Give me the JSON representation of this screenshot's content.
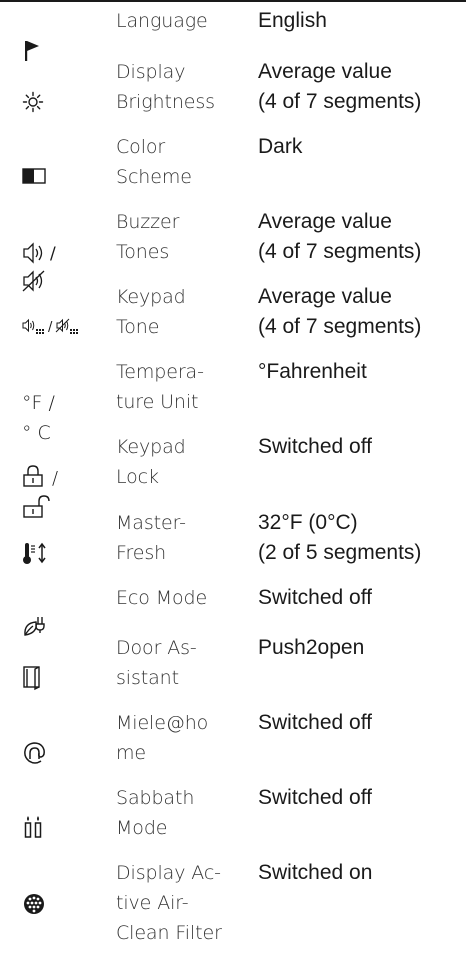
{
  "settings": [
    {
      "icon": "flag-icon",
      "symbol": "",
      "setting": "Language",
      "value": "English"
    },
    {
      "icon": "brightness-icon",
      "symbol": "",
      "setting": "Display\nBrightness",
      "value": "Average value\n(4 of 7 segments)"
    },
    {
      "icon": "color-scheme-icon",
      "symbol": "",
      "setting": "Color\nScheme",
      "value": "Dark"
    },
    {
      "icon": "buzzer-tones-icon",
      "symbol": "🔉) /\n🔇",
      "setting": "Buzzer\nTones",
      "value": "Average value\n(4 of 7 segments)"
    },
    {
      "icon": "keypad-tone-icon",
      "symbol": "",
      "setting": "Keypad\nTone",
      "value": "Average value\n(4 of 7 segments)"
    },
    {
      "icon": "temperature-unit-icon",
      "symbol": "°F /\n° C",
      "setting": "Tempera-\nture Unit",
      "value": "°Fahrenheit"
    },
    {
      "icon": "keypad-lock-icon",
      "symbol": "",
      "setting": "Keypad\nLock",
      "value": "Switched off"
    },
    {
      "icon": "masterfresh-icon",
      "symbol": "",
      "setting": "Master-\nFresh",
      "value": "32°F (0°C)\n(2 of 5 segments)"
    },
    {
      "icon": "eco-mode-icon",
      "symbol": "",
      "setting": "Eco Mode",
      "value": "Switched off"
    },
    {
      "icon": "door-assistant-icon",
      "symbol": "",
      "setting": "Door As-\nsistant",
      "value": "Push2open"
    },
    {
      "icon": "miele-home-icon",
      "symbol": "",
      "setting": "Miele@ho\nme",
      "value": "Switched off"
    },
    {
      "icon": "sabbath-mode-icon",
      "symbol": "",
      "setting": "Sabbath\nMode",
      "value": "Switched off"
    },
    {
      "icon": "air-clean-filter-icon",
      "symbol": "",
      "setting": "Display Ac-\ntive Air-\nClean Filter",
      "value": "Switched on"
    }
  ]
}
